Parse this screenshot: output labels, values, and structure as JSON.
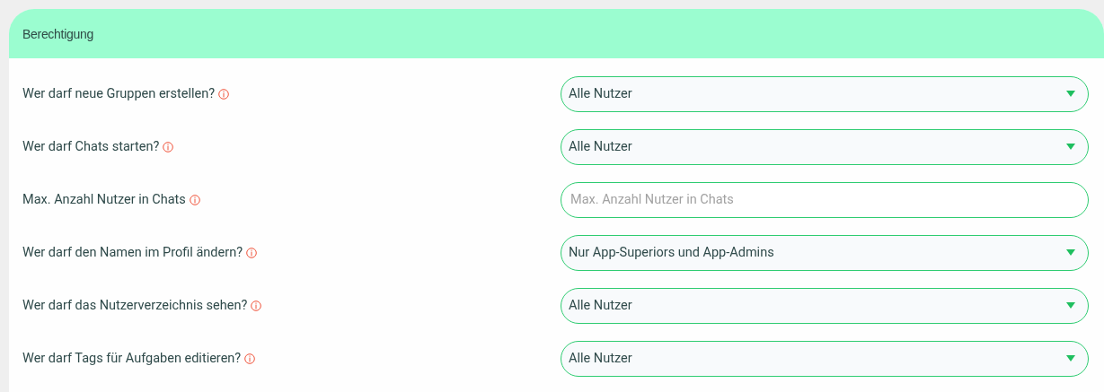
{
  "panel": {
    "title": "Berechtigung"
  },
  "rows": [
    {
      "label": "Wer darf neue Gruppen erstellen?",
      "kind": "select",
      "value": "Alle Nutzer"
    },
    {
      "label": "Wer darf Chats starten?",
      "kind": "select",
      "value": "Alle Nutzer"
    },
    {
      "label": "Max. Anzahl Nutzer in Chats",
      "kind": "input",
      "placeholder": "Max. Anzahl Nutzer in Chats"
    },
    {
      "label": "Wer darf den Namen im Profil ändern?",
      "kind": "select",
      "value": "Nur App-Superiors und App-Admins"
    },
    {
      "label": "Wer darf das Nutzerverzeichnis sehen?",
      "kind": "select",
      "value": "Alle Nutzer"
    },
    {
      "label": "Wer darf Tags für Aufgaben editieren?",
      "kind": "select",
      "value": "Alle Nutzer"
    }
  ]
}
